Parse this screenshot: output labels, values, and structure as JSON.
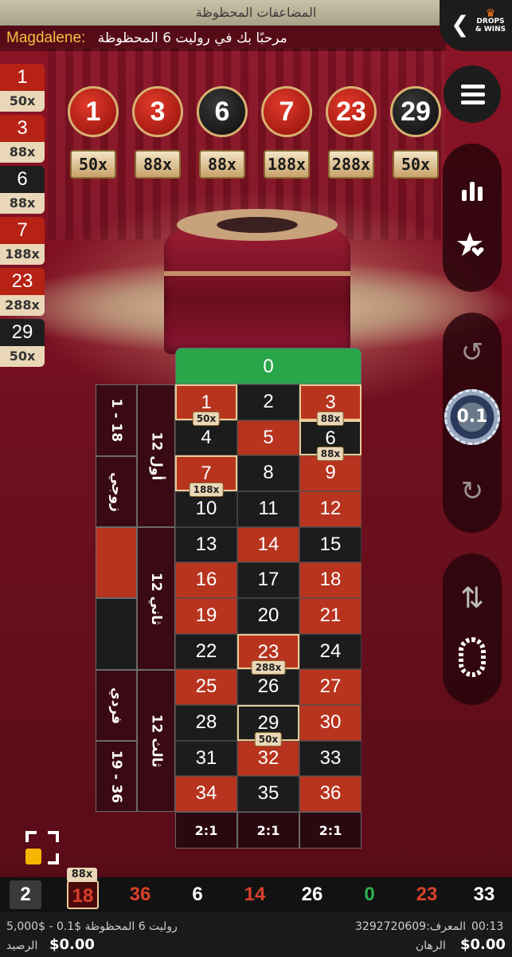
{
  "header": {
    "title": "المضاعفات المحظوظة",
    "player_name": "Magdalene:",
    "welcome_text": "مرحبًا بك في روليت 6 المحظوظة",
    "brand": "DROPS & WINS"
  },
  "lucky_numbers": [
    {
      "number": "1",
      "multiplier": "50x",
      "color": "red"
    },
    {
      "number": "3",
      "multiplier": "88x",
      "color": "red"
    },
    {
      "number": "6",
      "multiplier": "88x",
      "color": "black"
    },
    {
      "number": "7",
      "multiplier": "188x",
      "color": "red"
    },
    {
      "number": "23",
      "multiplier": "288x",
      "color": "red"
    },
    {
      "number": "29",
      "multiplier": "50x",
      "color": "black"
    }
  ],
  "lucky_ball_multipliers": [
    "50x",
    "88x",
    "88x",
    "188x",
    "288x",
    "50x"
  ],
  "board": {
    "zero": "0",
    "rows": [
      [
        "1",
        "2",
        "3"
      ],
      [
        "4",
        "5",
        "6"
      ],
      [
        "7",
        "8",
        "9"
      ],
      [
        "10",
        "11",
        "12"
      ],
      [
        "13",
        "14",
        "15"
      ],
      [
        "16",
        "17",
        "18"
      ],
      [
        "19",
        "20",
        "21"
      ],
      [
        "22",
        "23",
        "24"
      ],
      [
        "25",
        "26",
        "27"
      ],
      [
        "28",
        "29",
        "30"
      ],
      [
        "31",
        "32",
        "33"
      ],
      [
        "34",
        "35",
        "36"
      ]
    ],
    "columns": [
      "2:1",
      "2:1",
      "2:1"
    ],
    "dozens": [
      "12 أول",
      "12 ثاني",
      "12 ثالث"
    ],
    "outside": {
      "low": "1 - 18",
      "even": "زوجي",
      "odd": "فردي",
      "high": "19 - 36"
    }
  },
  "chip": {
    "value": "0.1"
  },
  "history": {
    "lucky_badge": "88x",
    "results": [
      {
        "value": "2",
        "color": "b"
      },
      {
        "value": "18",
        "color": "r"
      },
      {
        "value": "36",
        "color": "r"
      },
      {
        "value": "6",
        "color": "b"
      },
      {
        "value": "14",
        "color": "r"
      },
      {
        "value": "26",
        "color": "b"
      },
      {
        "value": "0",
        "color": "g"
      },
      {
        "value": "23",
        "color": "r"
      },
      {
        "value": "33",
        "color": "b"
      }
    ]
  },
  "footer": {
    "table_info": "روليت 6 المحظوظة  $0.1 - $5,000",
    "balance_label": "الرصيد",
    "balance": "$0.00",
    "game_id": "المعرف:3292720609",
    "time": "00:13",
    "bet_label": "الرهان",
    "bet": "$0.00"
  },
  "colors": {
    "red": "#b8341f",
    "black": "#1c1c1c",
    "green": "#2aa64a",
    "gold": "#e9d7b7"
  }
}
